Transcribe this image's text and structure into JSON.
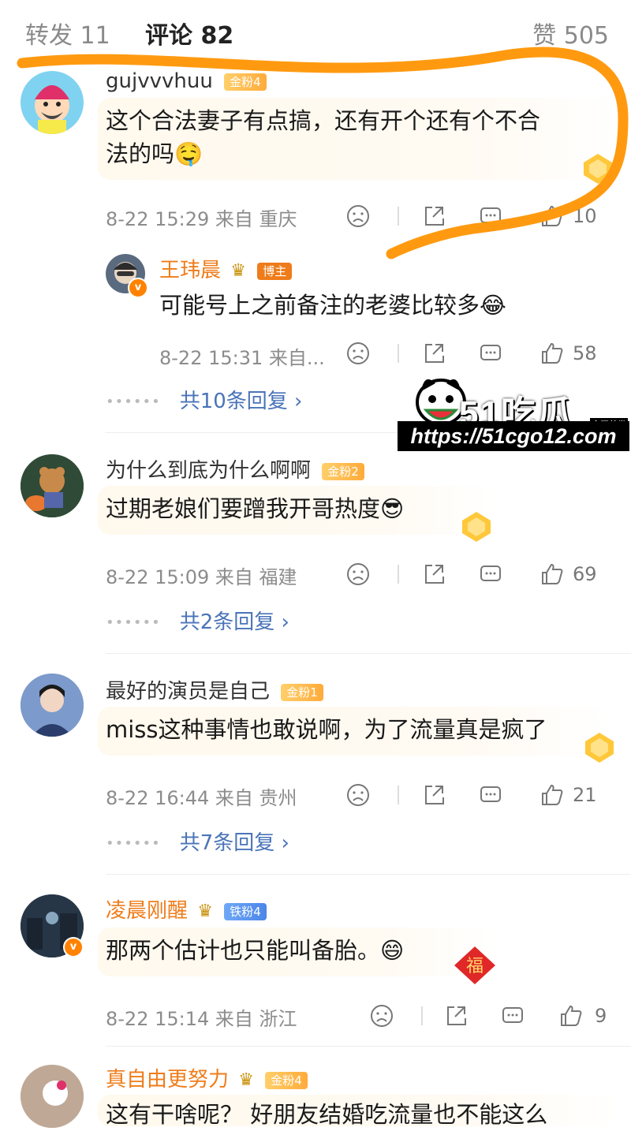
{
  "tabs": {
    "repost": "转发 11",
    "comments": "评论 82",
    "likes": "赞 505"
  },
  "colors": {
    "accent": "#ff8200",
    "reply_link": "#4a74b8",
    "meta": "#8c8c8c"
  },
  "comments": [
    {
      "user": "gujvvvhuu",
      "badge": "金粉4",
      "text_line1": "这个合法妻子有点搞，还有开个还有个不合",
      "text_line2": "法的吗🤤",
      "time": "8-22 15:29 来自 重庆",
      "likes": "10",
      "reply": {
        "user": "王玮晨",
        "badge": "博主",
        "text": "可能号上之前备注的老婆比较多😂",
        "time": "8-22 15:31 来自...",
        "likes": "58"
      },
      "replies_label": "共10条回复 ›"
    },
    {
      "user": "为什么到底为什么啊啊",
      "badge": "金粉2",
      "text": "过期老娘们要蹭我开哥热度😎",
      "time": "8-22 15:09 来自 福建",
      "likes": "69",
      "replies_label": "共2条回复 ›"
    },
    {
      "user": "最好的演员是自己",
      "badge": "金粉1",
      "text": "miss这种事情也敢说啊，为了流量真是疯了",
      "time": "8-22 16:44 来自 贵州",
      "likes": "21",
      "replies_label": "共7条回复 ›"
    },
    {
      "user": "凌晨刚醒",
      "badge": "铁粉4",
      "text": "那两个估计也只能叫备胎。😄",
      "time": "8-22 15:14 来自 浙江",
      "likes": "9"
    },
    {
      "user": "真自由更努力",
      "badge": "金粉4",
      "text": "这有干啥呢？ 好朋友结婚吃流量也不能这么"
    }
  ],
  "watermark": {
    "logo": "51吃瓜",
    "tag": "全网首发",
    "url": "https://51cgo12.com"
  },
  "icons": [
    "sad-face-icon",
    "share-icon",
    "comment-icon",
    "thumb-up-icon",
    "chevron-right-icon",
    "verified-icon",
    "crown-icon",
    "medal-icon"
  ]
}
